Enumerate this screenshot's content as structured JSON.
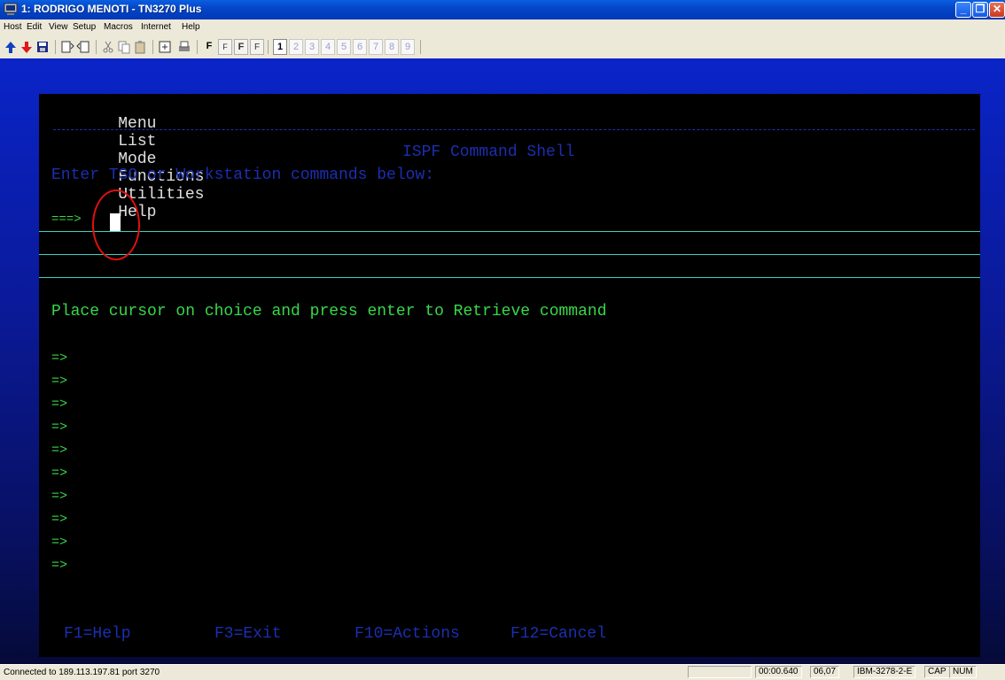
{
  "window": {
    "title": "1: RODRIGO MENOTI - TN3270 Plus",
    "minimize": "_",
    "maximize": "❐",
    "close": "✕"
  },
  "menubar": [
    "Host",
    "Edit",
    "View",
    "Setup",
    "Macros",
    "Internet",
    "Help"
  ],
  "toolbar": {
    "font_buttons": [
      "F",
      "F",
      "F",
      "F"
    ],
    "sessions": [
      "1",
      "2",
      "3",
      "4",
      "5",
      "6",
      "7",
      "8",
      "9"
    ],
    "active_session": "1"
  },
  "ispf": {
    "menu": [
      "Menu",
      "List",
      "Mode",
      "Functions",
      "Utilities",
      "Help"
    ],
    "panel_title": "ISPF Command Shell",
    "instruction": "Enter TSO or Workstation commands below:",
    "command_prompt": "===>",
    "command_value": "",
    "retrieve_text": "Place cursor on choice and press enter to Retrieve command",
    "retrieve_prompts": [
      "=>",
      "=>",
      "=>",
      "=>",
      "=>",
      "=>",
      "=>",
      "=>",
      "=>",
      "=>"
    ],
    "function_keys": [
      "F1=Help",
      "F3=Exit",
      "F10=Actions",
      "F12=Cancel"
    ]
  },
  "status": {
    "connection": "Connected to 189.113.197.81 port 3270",
    "timer": "00:00.640",
    "cursor_pos": "06,07",
    "terminal_type": "IBM-3278-2-E",
    "caps": "CAP",
    "num": "NUM"
  },
  "colors": {
    "title_bar": "#0546c8",
    "screen_bg": "#000000",
    "green_text": "#38d848",
    "blue_text": "#1b2fb0",
    "highlight_circle": "#e01010"
  }
}
